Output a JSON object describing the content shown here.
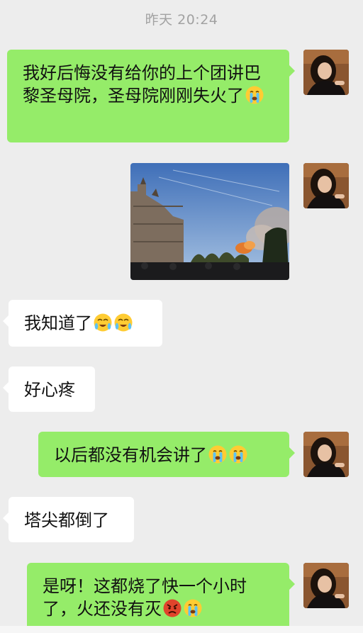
{
  "chat": {
    "timestamp": "昨天 20:24",
    "messages": [
      {
        "direction": "out",
        "type": "text",
        "text": "我好后悔没有给你的上个团讲巴黎圣母院，圣母院刚刚失火了",
        "emoji": [
          "crying-face"
        ]
      },
      {
        "direction": "out",
        "type": "image",
        "description_icon": "photo-notre-dame-fire"
      },
      {
        "direction": "in",
        "type": "text",
        "text": "我知道了",
        "emoji": [
          "loudly-crying-face",
          "loudly-crying-face"
        ]
      },
      {
        "direction": "in",
        "type": "text",
        "text": "好心疼",
        "emoji": []
      },
      {
        "direction": "out",
        "type": "text",
        "text": "以后都没有机会讲了",
        "emoji": [
          "crying-face",
          "crying-face"
        ]
      },
      {
        "direction": "in",
        "type": "text",
        "text": "塔尖都倒了",
        "emoji": []
      },
      {
        "direction": "out",
        "type": "text",
        "text": "是呀！这都烧了快一个小时了，火还没有灭",
        "emoji": [
          "angry-face",
          "crying-face"
        ]
      }
    ]
  },
  "colors": {
    "background": "#ededed",
    "outgoing_bubble": "#95ec69",
    "incoming_bubble": "#ffffff",
    "timestamp": "#a2a2a2"
  }
}
